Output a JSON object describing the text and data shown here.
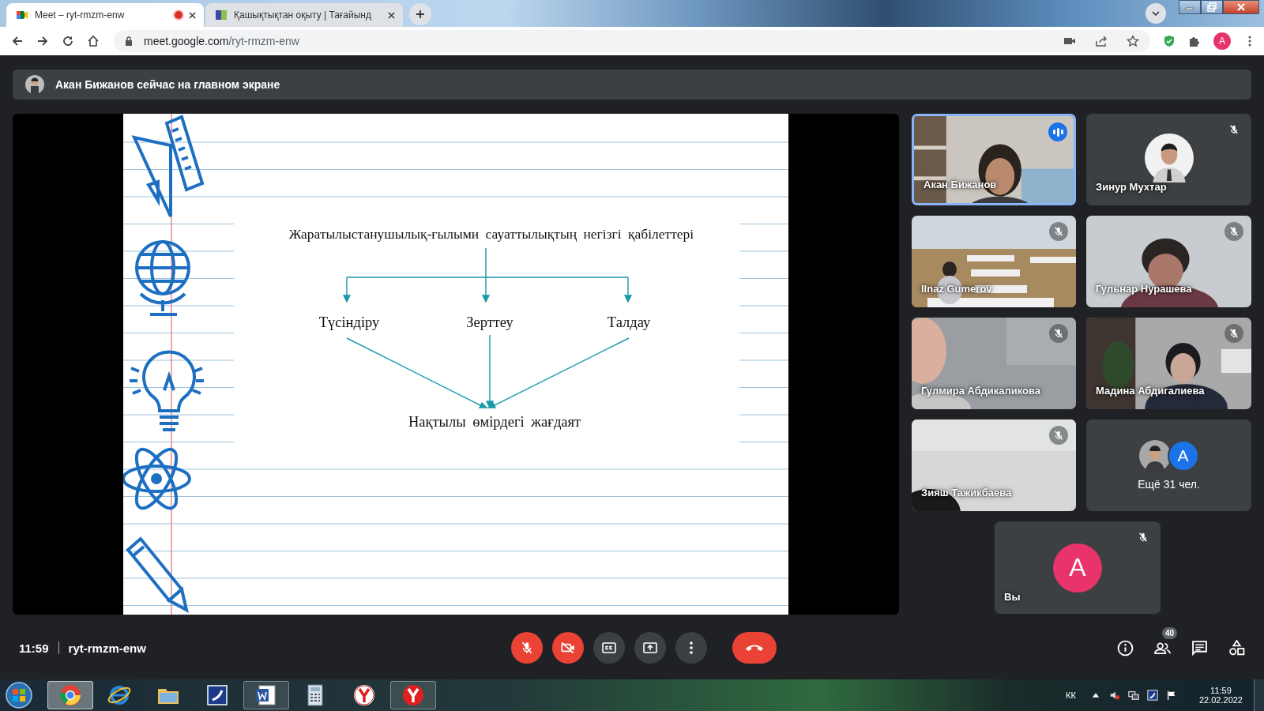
{
  "browser": {
    "tabs": [
      {
        "title": "Meet – ryt-rmzm-enw",
        "selected": true,
        "recording": true
      },
      {
        "title": "Қашықтықтан оқыту | Тағайынд",
        "selected": false,
        "recording": false
      }
    ],
    "url_host": "meet.google.com",
    "url_path": "/ryt-rmzm-enw",
    "profile_initial": "A"
  },
  "banner": {
    "text": "Акан Бижанов сейчас на главном экране"
  },
  "slide": {
    "title": "Жаратылыстанушылық-ғылыми сауаттылықтың негізгі қабілеттері",
    "branches": [
      "Түсіндіру",
      "Зерттеу",
      "Талдау"
    ],
    "result": "Нақтылы өмірдегі жағдаят"
  },
  "participants": [
    {
      "name": "Акан Бижанов",
      "kind": "video",
      "muted": false,
      "speaking": true
    },
    {
      "name": "Зинур Мухтар",
      "kind": "photo_avatar",
      "muted": true,
      "speaking": false
    },
    {
      "name": "Ilnaz Gumerov",
      "kind": "video",
      "muted": true,
      "speaking": false
    },
    {
      "name": "Гульнар Нурашева",
      "kind": "video",
      "muted": true,
      "speaking": false
    },
    {
      "name": "Гулмира Абдикаликова",
      "kind": "video",
      "muted": true,
      "speaking": false
    },
    {
      "name": "Мадина Абдигалиева",
      "kind": "video",
      "muted": true,
      "speaking": false
    },
    {
      "name": "Зияш Тажикбаева",
      "kind": "video",
      "muted": true,
      "speaking": false
    }
  ],
  "more": {
    "avatar_initial": "A",
    "label": "Ещё 31 чел."
  },
  "self": {
    "name": "Вы",
    "initial": "A",
    "muted": true
  },
  "meeting": {
    "time": "11:59",
    "code": "ryt-rmzm-enw",
    "people_count": "40",
    "mic_on": false,
    "camera_on": false
  },
  "taskbar": {
    "keyboard_layout": "КК",
    "clock_time": "11:59",
    "clock_date": "22.02.2022"
  }
}
